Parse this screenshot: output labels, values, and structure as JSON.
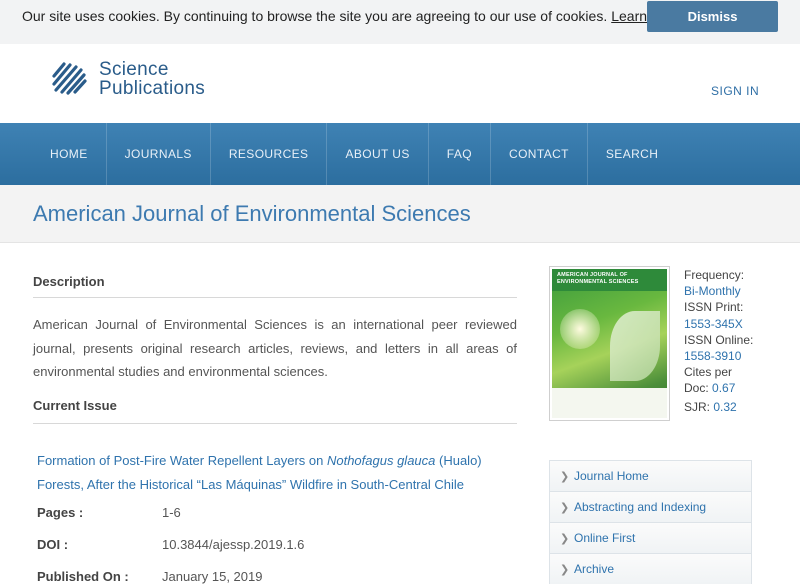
{
  "cookie": {
    "message": "Our site uses cookies. By continuing to browse the site you are agreeing to our use of cookies.",
    "learn_more": "Learn more",
    "dismiss": "Dismiss"
  },
  "header": {
    "logo_line1": "Science",
    "logo_line2": "Publications",
    "sign_in": "SIGN IN"
  },
  "nav": {
    "items": [
      "HOME",
      "JOURNALS",
      "RESOURCES",
      "ABOUT US",
      "FAQ",
      "CONTACT",
      "SEARCH"
    ]
  },
  "page_title": "American Journal of Environmental Sciences",
  "description": {
    "heading": "Description",
    "text": "American Journal of Environmental Sciences is an international peer reviewed journal, presents original research articles, reviews, and letters in all areas of environmental studies and environmental sciences."
  },
  "current_issue": {
    "heading": "Current Issue",
    "article_title_pre": "Formation of Post-Fire Water Repellent Layers on ",
    "article_title_italic": "Nothofagus glauca",
    "article_title_post": " (Hualo) Forests, After the Historical “Las Máquinas” Wildfire in South-Central Chile",
    "pages_label": "Pages :",
    "pages_value": "1-6",
    "doi_label": "DOI :",
    "doi_value": "10.3844/ajessp.2019.1.6",
    "published_label": "Published On :",
    "published_value": "January 15, 2019"
  },
  "journal_info": {
    "cover_title_1": "AMERICAN JOURNAL OF",
    "cover_title_2": "ENVIRONMENTAL SCIENCES",
    "frequency_label": "Frequency:",
    "frequency_value": "Bi-Monthly",
    "issn_print_label": "ISSN Print:",
    "issn_print_value": "1553-345X",
    "issn_online_label": "ISSN Online:",
    "issn_online_value": "1558-3910",
    "cites_label_1": "Cites per",
    "cites_label_2": "Doc:",
    "cites_value": "0.67",
    "sjr_label": "SJR:",
    "sjr_value": "0.32"
  },
  "side_menu": {
    "items": [
      "Journal Home",
      "Abstracting and Indexing",
      "Online First",
      "Archive"
    ]
  },
  "colors": {
    "accent": "#3d7ab0",
    "nav_bg": "#3479ab",
    "link": "#2f73ad",
    "dismiss_bg": "#4a7aa1"
  }
}
